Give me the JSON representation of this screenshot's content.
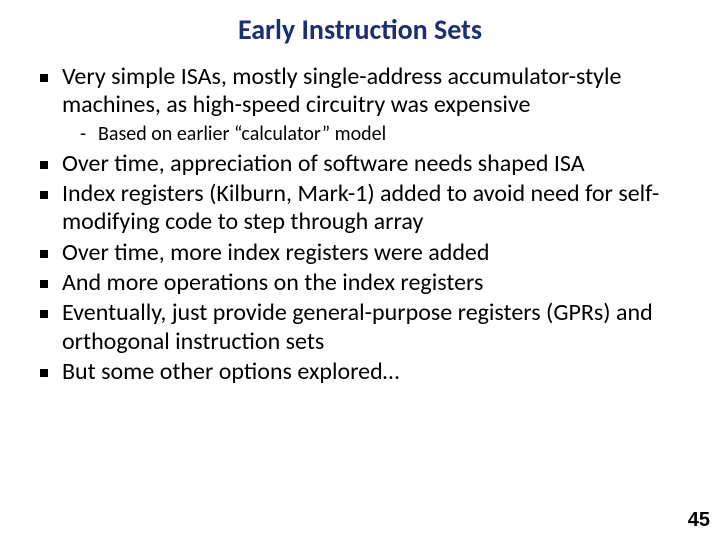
{
  "title": "Early Instruction Sets",
  "bullets": {
    "b0": "Very simple ISAs, mostly single-address accumulator-style machines, as high-speed circuitry was expensive",
    "b0_sub0": "Based on earlier “calculator” model",
    "b1": "Over time, appreciation of software needs shaped ISA",
    "b2": "Index registers (Kilburn, Mark-1) added to avoid need for self-modifying code to step through array",
    "b3": "Over time, more index registers were added",
    "b4": "And more operations on the index registers",
    "b5": "Eventually, just provide general-purpose registers (GPRs) and orthogonal instruction sets",
    "b6": "But some other options explored…"
  },
  "page_number": "45"
}
